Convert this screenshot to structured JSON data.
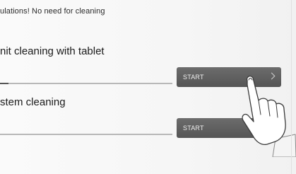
{
  "status": {
    "message": "ulations! No need for cleaning"
  },
  "sections": [
    {
      "title": "nit cleaning with tablet",
      "button_label": "START",
      "progress": 0.05
    },
    {
      "title": "stem cleaning",
      "button_label": "START",
      "progress": 0
    }
  ],
  "icons": {
    "chevron": "chevron-right-icon",
    "pointer": "pointing-hand-icon"
  },
  "colors": {
    "button": "#5f5f5f",
    "button_text": "#efefef",
    "track": "#b8b8b8"
  }
}
